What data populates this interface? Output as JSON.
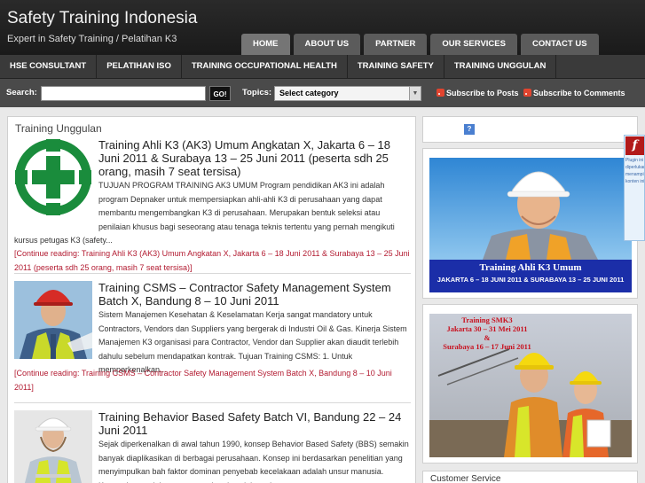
{
  "header": {
    "site_title": "Safety Training Indonesia",
    "tagline": "Expert in Safety Training / Pelatihan K3"
  },
  "top_nav": [
    {
      "label": "HOME",
      "active": true
    },
    {
      "label": "ABOUT US"
    },
    {
      "label": "PARTNER"
    },
    {
      "label": "OUR SERVICES"
    },
    {
      "label": "CONTACT US"
    }
  ],
  "category_nav": [
    {
      "label": "HSE CONSULTANT"
    },
    {
      "label": "PELATIHAN ISO"
    },
    {
      "label": "TRAINING OCCUPATIONAL HEALTH"
    },
    {
      "label": "TRAINING SAFETY"
    },
    {
      "label": "TRAINING UNGGULAN"
    }
  ],
  "search": {
    "label": "Search:",
    "value": "",
    "button": "GO!",
    "topics_label": "Topics:",
    "topics_selected": "Select category",
    "subscribe_posts": "Subscribe to Posts",
    "subscribe_comments": "Subscribe to Comments"
  },
  "main": {
    "section_title": "Training Unggulan",
    "posts": [
      {
        "title": "Training Ahli K3 (AK3) Umum Angkatan X, Jakarta 6 – 18 Juni 2011 & Surabaya 13 – 25 Juni 2011 (peserta sdh 25 orang, masih 7 seat tersisa)",
        "excerpt": "TUJUAN PROGRAM TRAINING AK3 UMUM Program pendidikan AK3 ini adalah program Depnaker untuk mempersiapkan ahli-ahli K3 di perusahaan yang dapat membantu mengembangkan K3 di perusahaan. Merupakan bentuk seleksi atau penilaian khusus bagi seseorang atau tenaga teknis tertentu yang pernah mengikuti",
        "excerpt_tail": "kursus petugas K3 (safety...",
        "more": "[Continue reading: Training Ahli K3 (AK3) Umum Angkatan X, Jakarta 6 – 18 Juni 2011 & Surabaya 13 – 25 Juni 2011 (peserta sdh 25 orang, masih 7 seat tersisa)]"
      },
      {
        "title": "Training CSMS – Contractor Safety Management System Batch X, Bandung 8 – 10 Juni 2011",
        "excerpt": "Sistem Manajemen Kesehatan & Keselamatan Kerja sangat mandatory untuk Contractors, Vendors dan Suppliers yang bergerak di Industri Oil & Gas. Kinerja Sistem Manajemen K3 organisasi para Contractor, Vendor dan Supplier akan diaudit terlebih dahulu sebelum mendapatkan kontrak. Tujuan Training CSMS: 1. Untuk memperkenalkan...",
        "more": "[Continue reading: Training CSMS – Contractor Safety Management System Batch X, Bandung 8 – 10 Juni 2011]"
      },
      {
        "title": "Training Behavior Based Safety Batch VI, Bandung 22 – 24 Juni 2011",
        "excerpt": "Sejak diperkenalkan di awal tahun 1990, konsep Behavior Based Safety (BBS) semakin banyak diaplikasikan di berbagai perusahaan. Konsep ini berdasarkan penelitian yang menyimpulkan bah faktor dominan penyebab kecelakaan adalah unsur manusia. Karena itu pendekatan pencegahan kecelakaan harus"
      }
    ]
  },
  "sidebar": {
    "help_icon": "?",
    "banner1": {
      "title": "Training Ahli K3 Umum",
      "subtitle": "JAKARTA 6 – 18 JUNI 2011 & SURABAYA 13 – 25 JUNI 2011"
    },
    "banner2": {
      "line1": "Training SMK3",
      "line2": "Jakarta 30 – 31 Mei 2011",
      "line3": "&",
      "line4": "Surabaya 16 – 17 Juni 2011"
    },
    "customer_service_title": "Customer Service"
  },
  "floating_widget": {
    "icon": "f",
    "text": "Plugin ini diperlukan untuk menampilkan konten ini"
  },
  "colors": {
    "header_bg": "#1f1f1f",
    "link_red": "#b21a30",
    "banner_blue": "#1b2ea8",
    "cross_green": "#1a8c3c"
  }
}
